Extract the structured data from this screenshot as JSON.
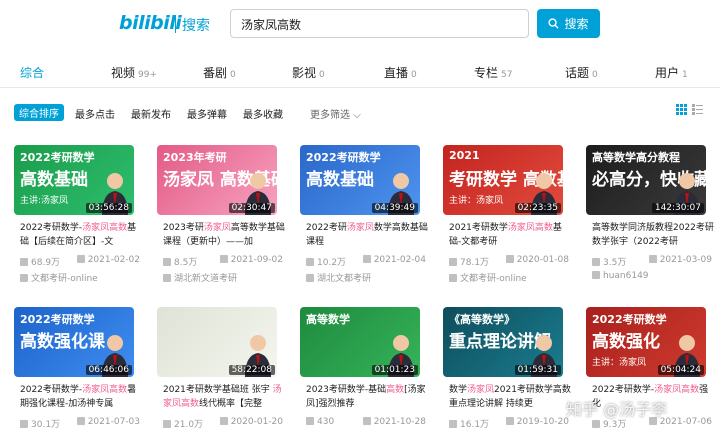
{
  "header": {
    "logo": "bilibili",
    "logo_sub": "搜索",
    "search_value": "汤家凤高数",
    "search_button": "搜索"
  },
  "tabs": [
    {
      "label": "综合",
      "count": ""
    },
    {
      "label": "视频",
      "count": "99+"
    },
    {
      "label": "番剧",
      "count": "0"
    },
    {
      "label": "影视",
      "count": "0"
    },
    {
      "label": "直播",
      "count": "0"
    },
    {
      "label": "专栏",
      "count": "57"
    },
    {
      "label": "话题",
      "count": "0"
    },
    {
      "label": "用户",
      "count": "1"
    }
  ],
  "filters": [
    "综合排序",
    "最多点击",
    "最新发布",
    "最多弹幕",
    "最多收藏"
  ],
  "more_filters": "更多筛选",
  "videos": [
    {
      "thumb_line1": "2022考研数学",
      "thumb_line2": "高数基础",
      "thumb_line3": "主讲:汤家凤",
      "duration": "03:56:28",
      "title_pre": "2022考研数学-",
      "title_hl": "汤家凤高数",
      "title_post": "基础【后续在简介区】-文",
      "views": "68.9万",
      "date": "2021-02-02",
      "uploader": "文都考研-online"
    },
    {
      "thumb_line1": "2023年考研",
      "thumb_line2": "汤家凤 高数基础",
      "thumb_line3": "",
      "duration": "02:30:47",
      "title_pre": "2023考研",
      "title_hl": "汤家凤",
      "title_post": "高等数学基础课程（更新中）——加",
      "views": "8.5万",
      "date": "2021-09-02",
      "uploader": "湖北新文道考研"
    },
    {
      "thumb_line1": "2022考研数学",
      "thumb_line2": "高数基础",
      "thumb_line3": "",
      "duration": "04:39:49",
      "title_pre": "2022考研",
      "title_hl": "汤家凤",
      "title_post": "数学高数基础课程",
      "views": "10.2万",
      "date": "2021-02-04",
      "uploader": "湖北文都考研"
    },
    {
      "thumb_line1": "2021",
      "thumb_line2": "考研数学 高数基础",
      "thumb_line3": "主讲：汤家凤",
      "duration": "02:23:35",
      "title_pre": "2021考研数学",
      "title_hl": "汤家凤高数",
      "title_post": "基础-文都考研",
      "views": "78.1万",
      "date": "2020-01-08",
      "uploader": "文都考研-online"
    },
    {
      "thumb_line1": "高等数学高分教程",
      "thumb_line2": "必高分，快收藏",
      "thumb_line3": "",
      "duration": "142:30:07",
      "title_pre": "高等数学同济版教程2022考研数学张宇（2022考研",
      "title_hl": "",
      "title_post": "",
      "views": "3.5万",
      "date": "2021-03-09",
      "uploader": "huan6149"
    },
    {
      "thumb_line1": "2022考研数学",
      "thumb_line2": "高数强化课",
      "thumb_line3": "",
      "duration": "06:46:06",
      "title_pre": "2022考研数学-",
      "title_hl": "汤家凤高数",
      "title_post": "暑期强化课程-加汤神专属",
      "views": "30.1万",
      "date": "2021-07-03",
      "uploader": ""
    },
    {
      "thumb_line1": "",
      "thumb_line2": "",
      "thumb_line3": "",
      "duration": "58:22:08",
      "title_pre": "2021考研数学基础班 张宇 ",
      "title_hl": "汤家凤高数",
      "title_post": "线代概率【完整",
      "views": "21.0万",
      "date": "2020-01-20",
      "uploader": ""
    },
    {
      "thumb_line1": "高等数学",
      "thumb_line2": "",
      "thumb_line3": "",
      "duration": "01:01:23",
      "title_pre": "2023考研数学-基础",
      "title_hl": "高数",
      "title_post": "[汤家凤]强烈推荐",
      "views": "430",
      "date": "2021-10-28",
      "uploader": ""
    },
    {
      "thumb_line1": "《高等数学》",
      "thumb_line2": "重点理论讲解",
      "thumb_line3": "",
      "duration": "01:59:31",
      "title_pre": "数学",
      "title_hl": "汤家凤",
      "title_post": "2021考研数学高数重点理论讲解 持续更",
      "views": "16.1万",
      "date": "2019-10-20",
      "uploader": ""
    },
    {
      "thumb_line1": "2022考研数学",
      "thumb_line2": "高数强化",
      "thumb_line3": "主讲：汤家凤",
      "duration": "05:04:24",
      "title_pre": "2022考研数学-",
      "title_hl": "汤家凤高数",
      "title_post": "强化",
      "views": "9.3万",
      "date": "2021-07-06",
      "uploader": ""
    }
  ],
  "watermark": "知乎 @汤子李",
  "colors": {
    "accent": "#00a1d6",
    "highlight": "#f25d8e"
  }
}
